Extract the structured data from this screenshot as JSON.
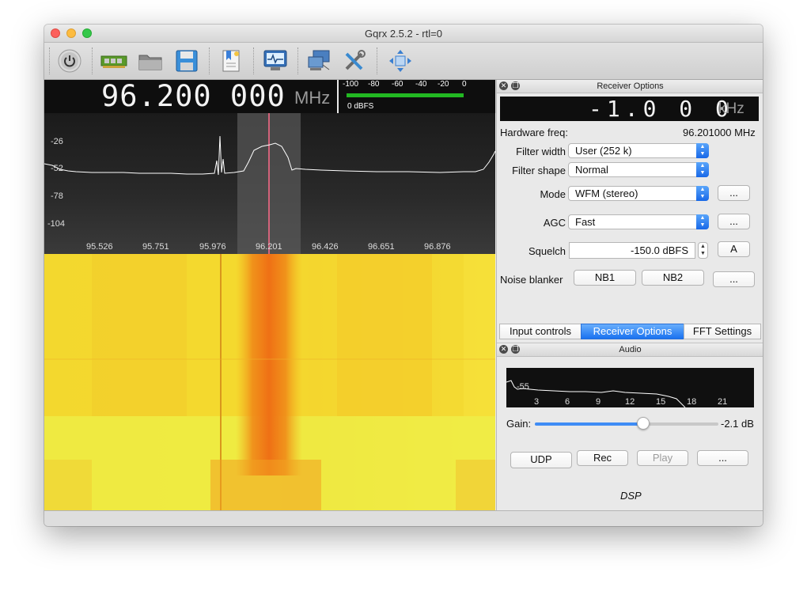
{
  "window": {
    "title": "Gqrx 2.5.2 - rtl=0"
  },
  "toolbar": {
    "icons": [
      "power-icon",
      "hardware-icon",
      "open-folder-icon",
      "save-icon",
      "bookmark-icon",
      "monitor-icon",
      "network-icon",
      "tools-icon",
      "fullscreen-icon"
    ]
  },
  "frequency": {
    "digits": "96.200 000",
    "unit": "MHz"
  },
  "smeter": {
    "scale": [
      "-100",
      "-80",
      "-60",
      "-40",
      "-20",
      "0"
    ],
    "label": "0 dBFS",
    "bar_color": "#22b822"
  },
  "spectrum": {
    "y_ticks": [
      "-26",
      "-52",
      "-78",
      "-104"
    ],
    "x_ticks": [
      "95.526",
      "95.751",
      "95.976",
      "96.201",
      "96.426",
      "96.651",
      "96.876"
    ],
    "marker_color": "#ff6b8a"
  },
  "receiver": {
    "title": "Receiver Options",
    "offset_digits": "-1.0 0 0",
    "offset_unit": "kHz",
    "hw_freq_label": "Hardware freq:",
    "hw_freq_value": "96.201000 MHz",
    "filter_width_label": "Filter width",
    "filter_width_value": "User (252 k)",
    "filter_shape_label": "Filter shape",
    "filter_shape_value": "Normal",
    "mode_label": "Mode",
    "mode_value": "WFM (stereo)",
    "agc_label": "AGC",
    "agc_value": "Fast",
    "squelch_label": "Squelch",
    "squelch_value": "-150.0 dBFS",
    "squelch_auto": "A",
    "noise_blanker_label": "Noise blanker",
    "nb1": "NB1",
    "nb2": "NB2",
    "more": "..."
  },
  "tabs": [
    "Input controls",
    "Receiver Options",
    "FFT Settings"
  ],
  "audio": {
    "title": "Audio",
    "plot_y_tick": "-55",
    "plot_x_ticks": [
      "3",
      "6",
      "9",
      "12",
      "15",
      "18",
      "21"
    ],
    "gain_label": "Gain:",
    "gain_value": "-2.1 dB",
    "gain_fraction": 0.59,
    "udp": "UDP",
    "rec": "Rec",
    "play": "Play",
    "more": "...",
    "dsp": "DSP"
  }
}
